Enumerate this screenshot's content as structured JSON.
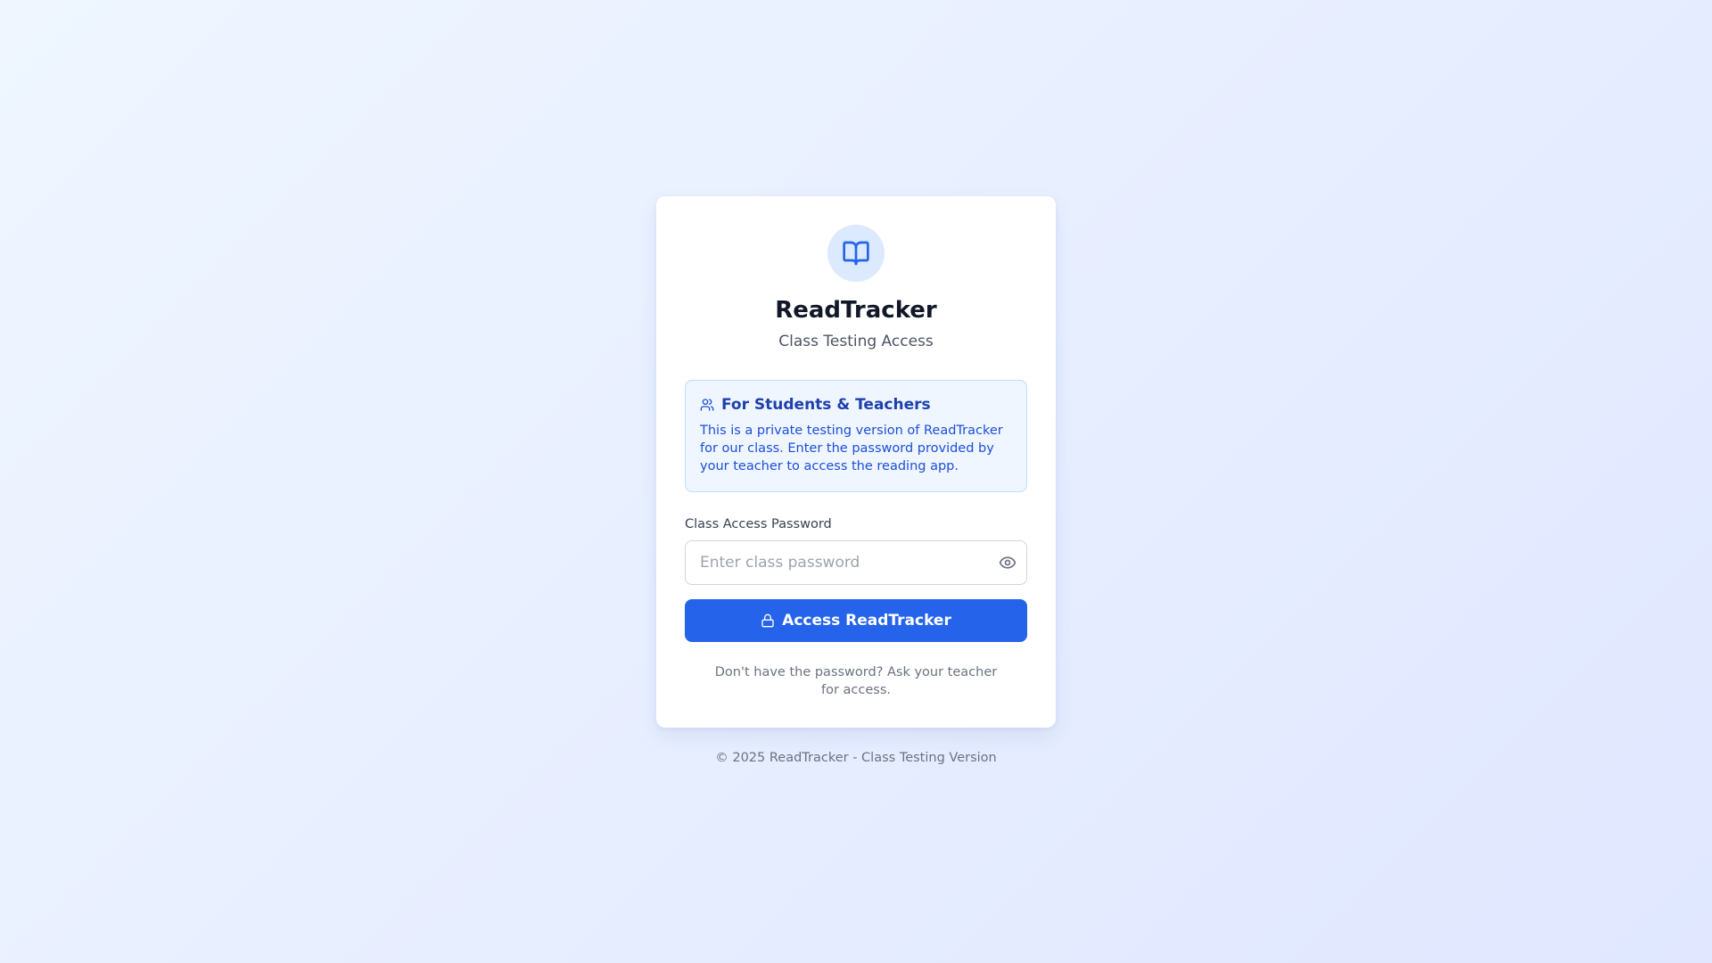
{
  "app": {
    "title": "ReadTracker",
    "subtitle": "Class Testing Access",
    "logo_icon": "book-open-icon",
    "accent_color": "#2563eb"
  },
  "info_box": {
    "icon": "users-icon",
    "title": "For Students & Teachers",
    "text": "This is a private testing version of ReadTracker for our class. Enter the password provided by your teacher to access the reading app."
  },
  "form": {
    "password_label": "Class Access Password",
    "password_placeholder": "Enter class password",
    "password_value": "",
    "toggle_icon": "eye-icon",
    "submit_icon": "lock-icon",
    "submit_label": "Access ReadTracker",
    "help_text": "Don't have the password? Ask your teacher for access."
  },
  "footer": {
    "text": "© 2025 ReadTracker - Class Testing Version"
  }
}
